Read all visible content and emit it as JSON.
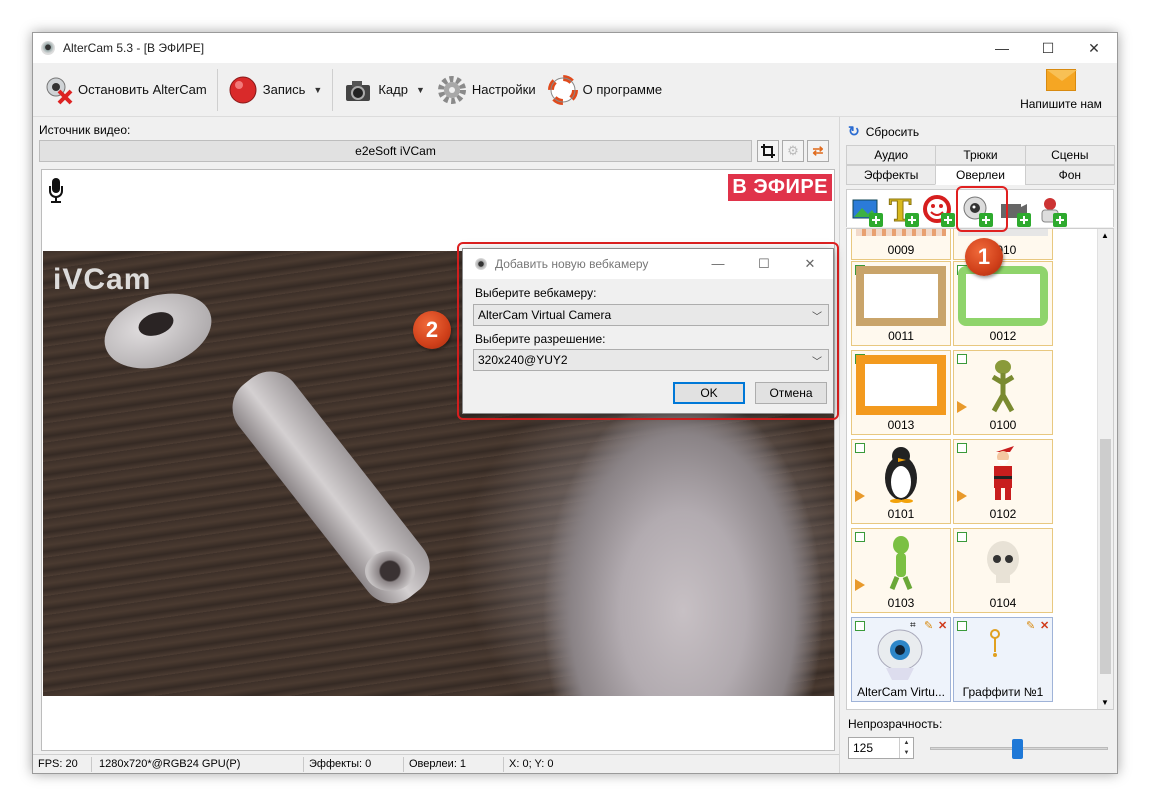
{
  "window": {
    "title": "AlterCam 5.3 - [В ЭФИРЕ]",
    "minimize": "—",
    "maximize": "☐",
    "close": "✕"
  },
  "toolbar": {
    "stop_label": "Остановить AlterCam",
    "record_label": "Запись",
    "frame_label": "Кадр",
    "settings_label": "Настройки",
    "about_label": "О программе",
    "mail_label": "Напишите нам",
    "dropdown_glyph": "▼"
  },
  "source": {
    "label": "Источник видео:",
    "value": "e2eSoft iVCam"
  },
  "preview": {
    "onair": "В ЭФИРЕ",
    "watermark": "iVCam"
  },
  "status": {
    "fps": "FPS: 20",
    "format": "1280x720*@RGB24 GPU(P)",
    "effects": "Эффекты: 0",
    "overlays": "Оверлеи: 1",
    "coords": "X: 0; Y: 0"
  },
  "panel": {
    "reset_label": "Сбросить",
    "tabs_row1": [
      "Аудио",
      "Трюки",
      "Сцены"
    ],
    "tabs_row2": [
      "Эффекты",
      "Оверлеи",
      "Фон"
    ],
    "active_tab": "Оверлеи",
    "items": [
      {
        "label": "0009"
      },
      {
        "label": "0010"
      },
      {
        "label": "0011"
      },
      {
        "label": "0012"
      },
      {
        "label": "0013"
      },
      {
        "label": "0100"
      },
      {
        "label": "0101"
      },
      {
        "label": "0102"
      },
      {
        "label": "0103"
      },
      {
        "label": "0104"
      },
      {
        "label": "AlterCam Virtu..."
      },
      {
        "label": "Граффити №1"
      }
    ],
    "opacity_label": "Непрозрачность:",
    "opacity_value": "125",
    "opacity_fraction": 0.49
  },
  "dialog": {
    "title": "Добавить новую вебкамеру",
    "camera_label": "Выберите вебкамеру:",
    "camera_value": "AlterCam Virtual Camera",
    "resolution_label": "Выберите разрешение:",
    "resolution_value": "320x240@YUY2",
    "ok_label": "OK",
    "cancel_label": "Отмена"
  },
  "callouts": {
    "one": "1",
    "two": "2"
  },
  "colors": {
    "onair_bg": "#e0334a",
    "callout": "#e02020",
    "accent": "#0078d7"
  }
}
